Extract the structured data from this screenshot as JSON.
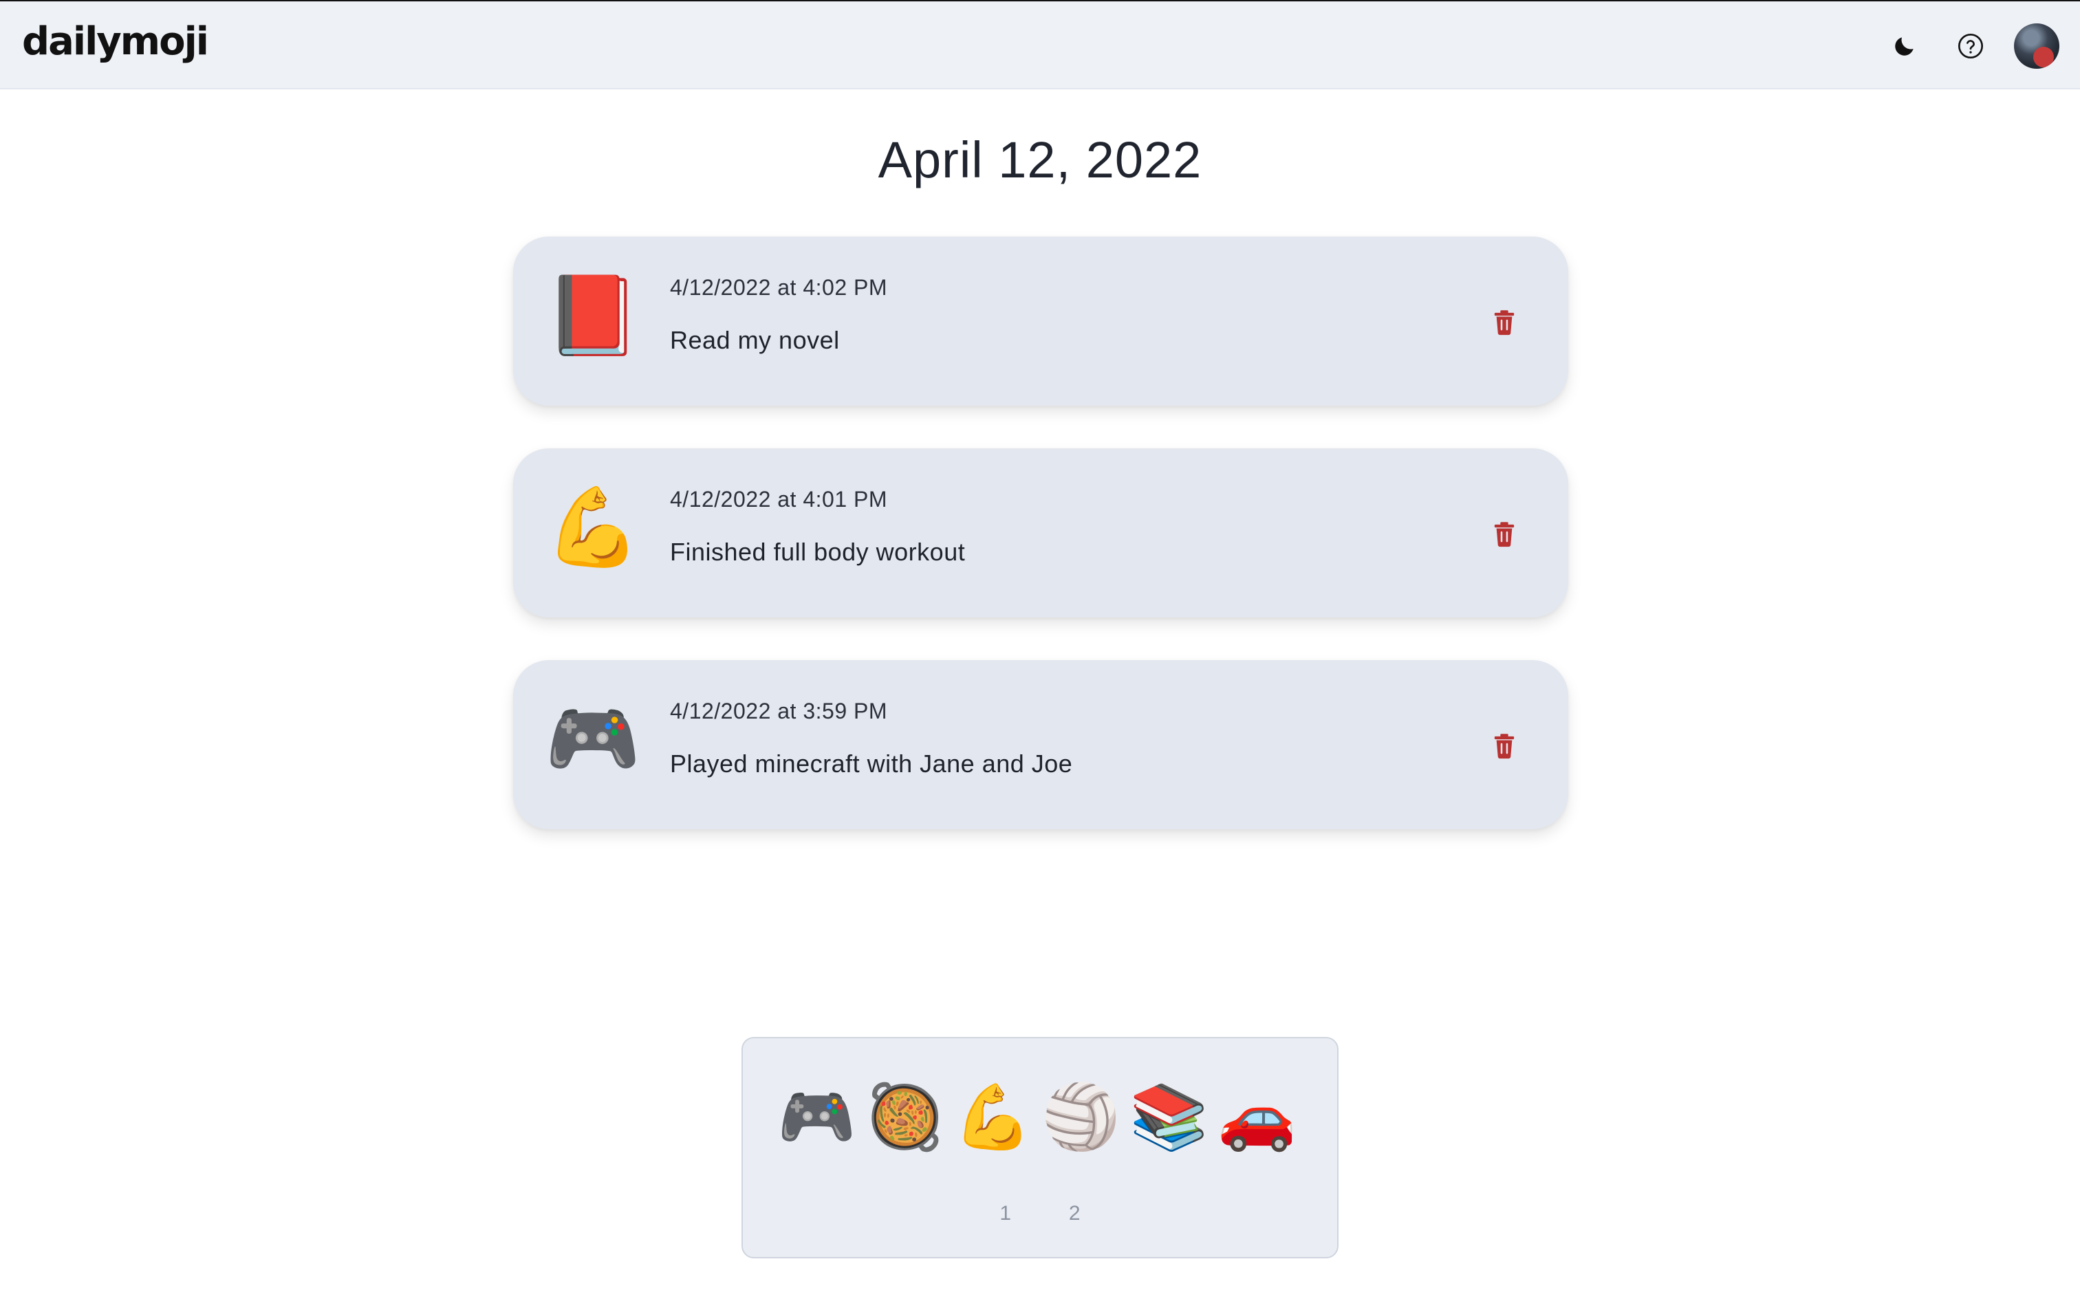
{
  "app": {
    "logo": "dailymoji"
  },
  "header": {
    "icons": [
      "moon-icon",
      "help-icon",
      "avatar"
    ]
  },
  "page": {
    "date_title": "April 12, 2022"
  },
  "entries": [
    {
      "emoji": "📕",
      "emoji_name": "red-book-icon",
      "time": "4/12/2022 at 4:02 PM",
      "text": "Read my novel"
    },
    {
      "emoji": "💪",
      "emoji_name": "flexed-biceps-icon",
      "time": "4/12/2022 at 4:01 PM",
      "text": "Finished full body workout"
    },
    {
      "emoji": "🎮",
      "emoji_name": "game-controller-icon",
      "time": "4/12/2022 at 3:59 PM",
      "text": "Played minecraft with Jane and Joe"
    }
  ],
  "emoji_tray": {
    "emojis": [
      {
        "char": "🎮",
        "name": "game-controller-icon"
      },
      {
        "char": "🥘",
        "name": "paella-pan-icon"
      },
      {
        "char": "💪",
        "name": "flexed-biceps-icon"
      },
      {
        "char": "🏐",
        "name": "volleyball-icon"
      },
      {
        "char": "📚",
        "name": "books-icon"
      },
      {
        "char": "🚗",
        "name": "car-icon"
      }
    ],
    "pages": [
      "1",
      "2"
    ]
  },
  "colors": {
    "header_bg": "#eef1f6",
    "card_bg": "#e3e7ef",
    "trash_red": "#b83232",
    "page_num_gray": "#8b93a1"
  }
}
